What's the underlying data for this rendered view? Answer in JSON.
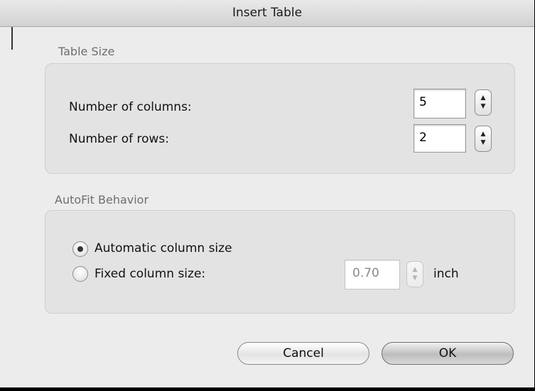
{
  "dialog": {
    "title": "Insert Table"
  },
  "table_size": {
    "section_label": "Table Size",
    "columns_label": "Number of columns:",
    "columns_value": "5",
    "rows_label": "Number of rows:",
    "rows_value": "2"
  },
  "autofit": {
    "section_label": "AutoFit Behavior",
    "options": [
      {
        "label": "Automatic column size",
        "selected": true
      },
      {
        "label": "Fixed column size:",
        "selected": false
      }
    ],
    "fixed_value": "0.70",
    "fixed_unit": "inch"
  },
  "buttons": {
    "cancel_label": "Cancel",
    "ok_label": "OK"
  },
  "icons": {
    "stepper_up": "stepper-up-arrow",
    "stepper_down": "stepper-down-arrow"
  }
}
